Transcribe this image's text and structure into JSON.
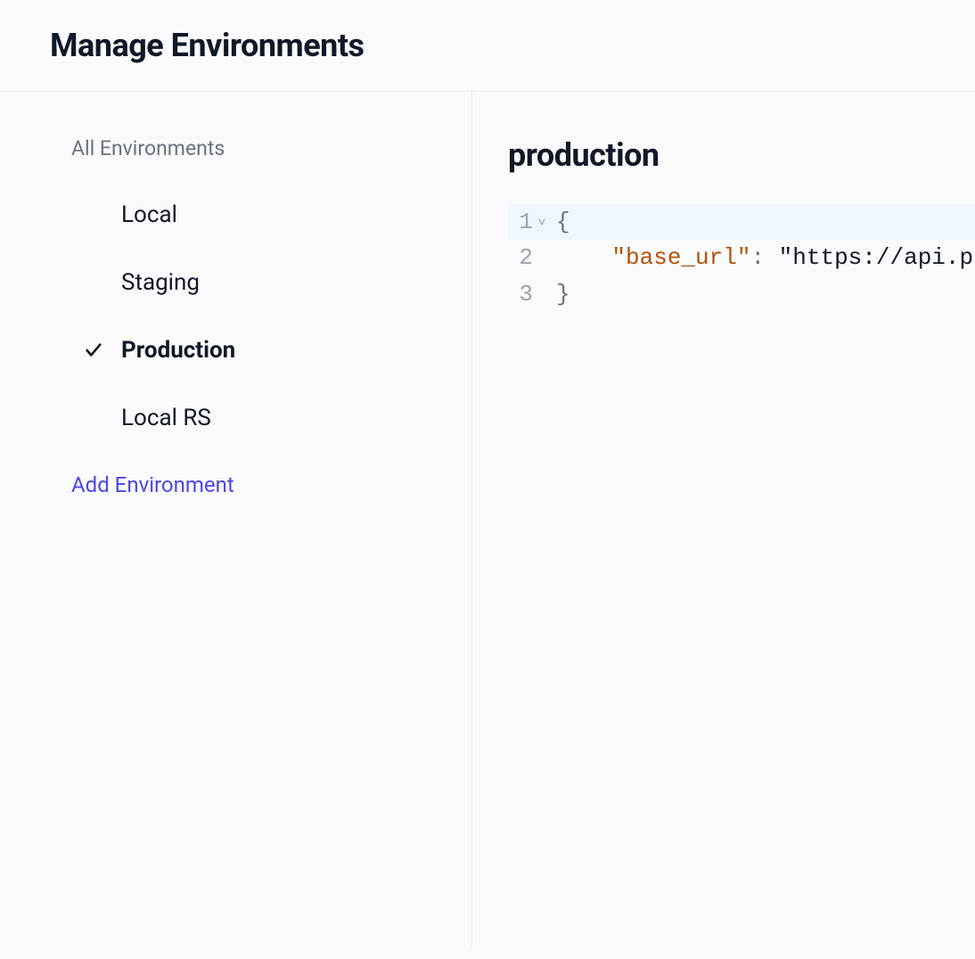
{
  "header": {
    "title": "Manage Environments"
  },
  "sidebar": {
    "heading": "All Environments",
    "items": [
      {
        "label": "Local",
        "selected": false
      },
      {
        "label": "Staging",
        "selected": false
      },
      {
        "label": "Production",
        "selected": true
      },
      {
        "label": "Local RS",
        "selected": false
      }
    ],
    "add_label": "Add Environment"
  },
  "main": {
    "title": "production",
    "editor": {
      "lines": [
        {
          "num": "1",
          "fold": "˅",
          "active": true,
          "tokens": [
            {
              "t": "punc",
              "v": "{"
            }
          ]
        },
        {
          "num": "2",
          "fold": "",
          "active": false,
          "indent": "    ",
          "tokens": [
            {
              "t": "key",
              "v": "\"base_url\""
            },
            {
              "t": "punc",
              "v": ": "
            },
            {
              "t": "str",
              "v": "\"https://api.p"
            }
          ]
        },
        {
          "num": "3",
          "fold": "",
          "active": false,
          "tokens": [
            {
              "t": "punc",
              "v": "}"
            }
          ]
        }
      ]
    }
  }
}
